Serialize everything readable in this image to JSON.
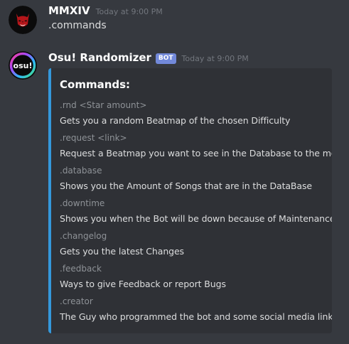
{
  "messages": [
    {
      "author": "MMXIV",
      "timestamp": "Today at 9:00 PM",
      "content": ".commands",
      "avatar_icon": "red-oni-mask-icon"
    },
    {
      "author": "Osu! Randomizer",
      "bot_tag": "BOT",
      "timestamp": "Today at 9:00 PM",
      "avatar_icon": "osu-logo-icon",
      "avatar_text": "osu!",
      "embed": {
        "accent_color": "#3498db",
        "title": "Commands:",
        "fields": [
          {
            "name": ".rnd <Star amount>",
            "value": "Gets you a random Beatmap of the chosen Difficulty"
          },
          {
            "name": ".request <link>",
            "value": "Request a Beatmap you want to see in the Database to the mod"
          },
          {
            "name": ".database",
            "value": "Shows you the Amount of Songs that are in the DataBase"
          },
          {
            "name": ".downtime",
            "value": "Shows you when the Bot will be down because of Maintenance"
          },
          {
            "name": ".changelog",
            "value": "Gets you the latest Changes"
          },
          {
            "name": ".feedback",
            "value": "Ways to give Feedback or report Bugs"
          },
          {
            "name": ".creator",
            "value": "The Guy who programmed the bot and some social media links"
          }
        ]
      }
    }
  ],
  "colors": {
    "background": "#36393f",
    "embed_background": "#2f3136",
    "bot_tag": "#7289da",
    "timestamp": "#72767d"
  }
}
